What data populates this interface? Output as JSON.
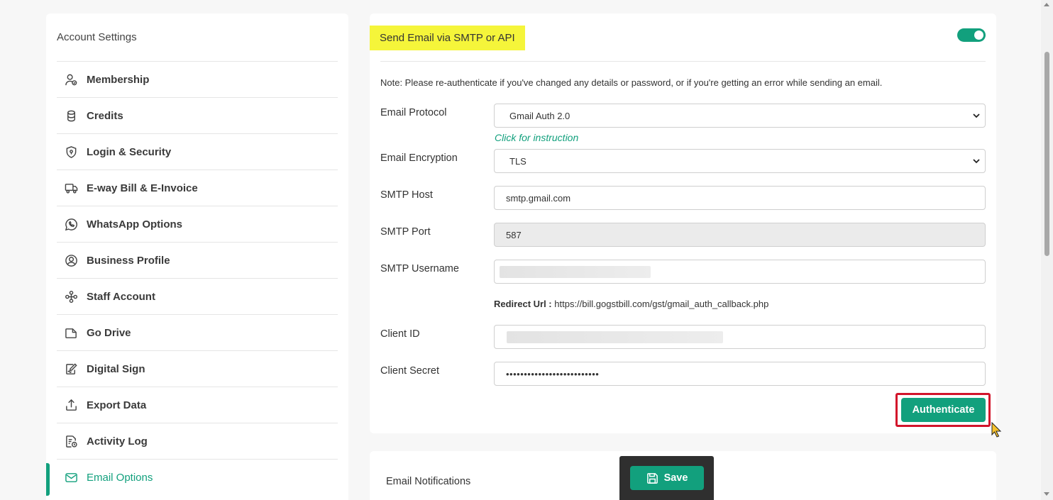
{
  "sidebar": {
    "title": "Account Settings",
    "items": [
      {
        "label": "Membership",
        "icon": "user-badge-icon"
      },
      {
        "label": "Credits",
        "icon": "coins-icon"
      },
      {
        "label": "Login & Security",
        "icon": "shield-icon"
      },
      {
        "label": "E-way Bill & E-Invoice",
        "icon": "truck-icon"
      },
      {
        "label": "WhatsApp Options",
        "icon": "whatsapp-icon"
      },
      {
        "label": "Business Profile",
        "icon": "user-circle-icon"
      },
      {
        "label": "Staff Account",
        "icon": "staff-icon"
      },
      {
        "label": "Go Drive",
        "icon": "drive-icon"
      },
      {
        "label": "Digital Sign",
        "icon": "signature-icon"
      },
      {
        "label": "Export Data",
        "icon": "export-icon"
      },
      {
        "label": "Activity Log",
        "icon": "activity-log-icon"
      },
      {
        "label": "Email Options",
        "icon": "envelope-icon",
        "active": true
      }
    ]
  },
  "smtp": {
    "title": "Send Email via SMTP or API",
    "enabled": true,
    "note": "Note: Please re-authenticate if you've changed any details or password, or if you're getting an error while sending an email.",
    "protocol_label": "Email Protocol",
    "protocol_value": "Gmail Auth 2.0",
    "instruction_link": "Click for instruction",
    "encryption_label": "Email Encryption",
    "encryption_value": "TLS",
    "host_label": "SMTP Host",
    "host_value": "smtp.gmail.com",
    "port_label": "SMTP Port",
    "port_value": "587",
    "username_label": "SMTP Username",
    "redirect_label": "Redirect Url :",
    "redirect_value": "https://bill.gogstbill.com/gst/gmail_auth_callback.php",
    "client_id_label": "Client ID",
    "client_secret_label": "Client Secret",
    "client_secret_value": "••••••••••••••••••••••••••",
    "authenticate_label": "Authenticate"
  },
  "notifications": {
    "title": "Email Notifications"
  },
  "savebar": {
    "save_label": "Save"
  },
  "colors": {
    "accent": "#12a07d",
    "highlight": "#f5f53a",
    "frame": "#d2142b"
  }
}
